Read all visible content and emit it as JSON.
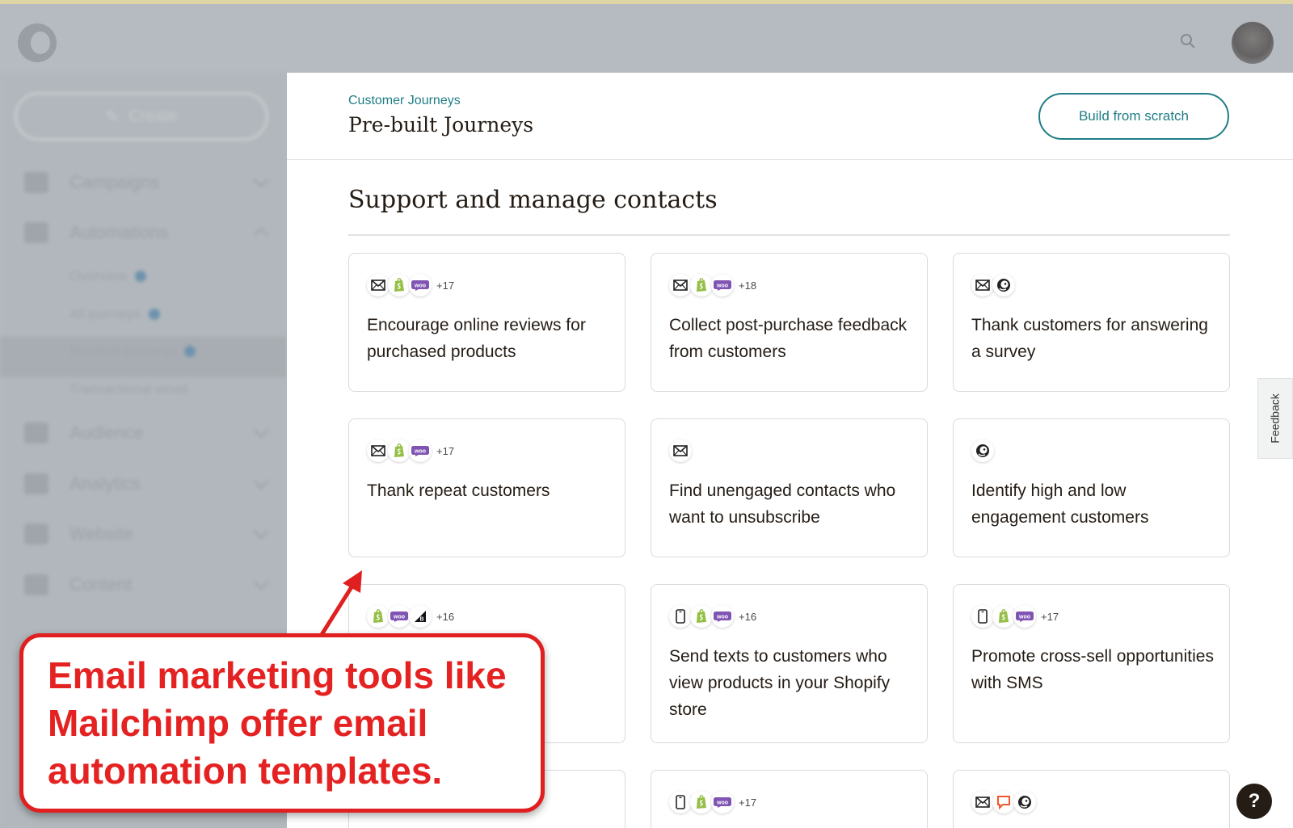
{
  "header": {
    "logo_icon": "mailchimp-freddie-icon",
    "search_icon": "search-icon",
    "avatar_icon": "user-avatar"
  },
  "sidebar": {
    "create_label": "Create",
    "items": [
      {
        "label": "Campaigns"
      },
      {
        "label": "Automations"
      },
      {
        "label": "Audience"
      },
      {
        "label": "Analytics"
      },
      {
        "label": "Website"
      },
      {
        "label": "Content"
      }
    ],
    "sub_items": [
      {
        "label": "Overview"
      },
      {
        "label": "All journeys"
      },
      {
        "label": "Pre-built journeys"
      },
      {
        "label": "Transactional email"
      }
    ]
  },
  "page": {
    "breadcrumb": "Customer Journeys",
    "title": "Pre-built Journeys",
    "build_button": "Build from scratch",
    "section_title": "Support and manage contacts"
  },
  "cards": [
    {
      "title": "Encourage online reviews for purchased products",
      "icons": [
        "email-icon",
        "shopify-icon",
        "woo-icon"
      ],
      "more": "+17"
    },
    {
      "title": "Collect post-purchase feedback from customers",
      "icons": [
        "email-icon",
        "shopify-icon",
        "woo-icon"
      ],
      "more": "+18"
    },
    {
      "title": "Thank customers for answering a survey",
      "icons": [
        "email-icon",
        "mailchimp-icon"
      ],
      "more": ""
    },
    {
      "title": "Thank repeat customers",
      "icons": [
        "email-icon",
        "shopify-icon",
        "woo-icon"
      ],
      "more": "+17"
    },
    {
      "title": "Find unengaged contacts who want to unsubscribe",
      "icons": [
        "email-icon"
      ],
      "more": ""
    },
    {
      "title": "Identify high and low engagement customers",
      "icons": [
        "mailchimp-icon"
      ],
      "more": ""
    },
    {
      "title": "",
      "icons": [
        "shopify-icon",
        "woo-icon",
        "bigcommerce-icon"
      ],
      "more": "+16"
    },
    {
      "title": "Send texts to customers who view products in your Shopify store",
      "icons": [
        "sms-icon",
        "shopify-icon",
        "woo-icon"
      ],
      "more": "+16"
    },
    {
      "title": "Promote cross-sell opportunities with SMS",
      "icons": [
        "sms-icon",
        "shopify-icon",
        "woo-icon"
      ],
      "more": "+17"
    },
    {
      "title": "",
      "icons": [],
      "more": ""
    },
    {
      "title": "",
      "icons": [
        "sms-icon",
        "shopify-icon",
        "woo-icon"
      ],
      "more": "+17"
    },
    {
      "title": "",
      "icons": [
        "email-icon",
        "chat-icon",
        "mailchimp-icon"
      ],
      "more": ""
    }
  ],
  "widgets": {
    "feedback_label": "Feedback",
    "help_label": "?"
  },
  "annotation": {
    "text": "Email marketing tools like Mailchimp offer email automation templates.",
    "color": "#e52222"
  },
  "colors": {
    "accent_teal": "#1f7d86",
    "text_dark": "#241c15",
    "shopify_green": "#95bf47",
    "woo_purple": "#7f54b3",
    "chat_orange": "#f2572b"
  }
}
